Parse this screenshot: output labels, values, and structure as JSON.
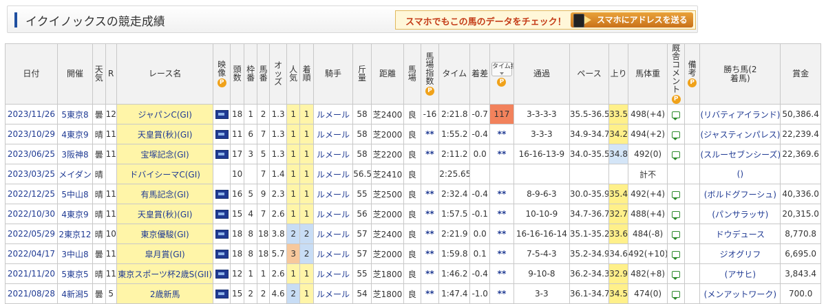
{
  "header": {
    "title": "イクイノックスの競走成績",
    "promo_text": "スマホでもこの馬のデータをチェック！",
    "promo_button": "スマホにアドレスを送る"
  },
  "columns": {
    "date": "日付",
    "venue": "開催",
    "weather": "天気",
    "r": "R",
    "race": "レース名",
    "video": "映像",
    "heads": "頭数",
    "frame": "枠番",
    "horse_no": "馬番",
    "odds": "オッズ",
    "pop": "人気",
    "rank": "着順",
    "jockey": "騎手",
    "weight": "斤量",
    "dist": "距離",
    "track": "馬場",
    "track_idx": "馬場指数",
    "time": "タイム",
    "margin": "着差",
    "time_idx": "タイム指数",
    "pass": "通過",
    "pace": "ペース",
    "last": "上り",
    "body": "馬体重",
    "stable": "厩舎コメント",
    "note": "備考",
    "winner": "勝ち馬(2着馬)",
    "prize": "賞金",
    "p": "P"
  },
  "rows": [
    {
      "date": "2023/11/26",
      "venue": "5東京8",
      "weather": "曇",
      "r": "12",
      "race": "ジャパンC(GI)",
      "video": true,
      "heads": "18",
      "frame": "1",
      "horse_no": "2",
      "odds": "1.3",
      "pop": "1",
      "rank": "1",
      "jockey": "ルメール",
      "weight": "58",
      "dist": "芝2400",
      "track": "良",
      "track_idx": "-16",
      "time": "2:21.8",
      "margin": "-0.7",
      "time_idx": "117",
      "pass": "3-3-3-3",
      "pace": "35.5-36.5",
      "last": "33.5",
      "body": "498(+4)",
      "comment": true,
      "winner": "(リバティアイランド)",
      "prize": "50,386.4"
    },
    {
      "date": "2023/10/29",
      "venue": "4東京9",
      "weather": "晴",
      "r": "11",
      "race": "天皇賞(秋)(GI)",
      "video": true,
      "heads": "11",
      "frame": "6",
      "horse_no": "7",
      "odds": "1.3",
      "pop": "1",
      "rank": "1",
      "jockey": "ルメール",
      "weight": "58",
      "dist": "芝2000",
      "track": "良",
      "track_idx": "**",
      "time": "1:55.2",
      "margin": "-0.4",
      "time_idx": "**",
      "pass": "3-3-3",
      "pace": "34.9-34.7",
      "last": "34.2",
      "body": "494(+2)",
      "comment": true,
      "winner": "(ジャスティンパレス)",
      "prize": "22,239.4"
    },
    {
      "date": "2023/06/25",
      "venue": "3阪神8",
      "weather": "曇",
      "r": "11",
      "race": "宝塚記念(GI)",
      "video": true,
      "heads": "17",
      "frame": "3",
      "horse_no": "5",
      "odds": "1.3",
      "pop": "1",
      "rank": "1",
      "jockey": "ルメール",
      "weight": "58",
      "dist": "芝2200",
      "track": "良",
      "track_idx": "**",
      "time": "2:11.2",
      "margin": "0.0",
      "time_idx": "**",
      "pass": "16-16-13-9",
      "pace": "34.0-35.5",
      "last": "34.8",
      "body": "492(0)",
      "comment": true,
      "winner": "(スルーセブンシーズ)",
      "prize": "22,369.6"
    },
    {
      "date": "2023/03/25",
      "venue": "メイダン",
      "weather": "晴",
      "r": "",
      "race": "ドバイシーマC(GI)",
      "video": false,
      "heads": "10",
      "frame": "",
      "horse_no": "7",
      "odds": "1.4",
      "pop": "1",
      "rank": "1",
      "jockey": "ルメール",
      "weight": "56.5",
      "dist": "芝2410",
      "track": "良",
      "track_idx": "",
      "time": "2:25.65",
      "margin": "",
      "time_idx": "",
      "pass": "",
      "pace": "",
      "last": "",
      "body": "計不",
      "comment": false,
      "winner": "()",
      "prize": ""
    },
    {
      "date": "2022/12/25",
      "venue": "5中山8",
      "weather": "晴",
      "r": "11",
      "race": "有馬記念(GI)",
      "video": true,
      "heads": "16",
      "frame": "5",
      "horse_no": "9",
      "odds": "2.3",
      "pop": "1",
      "rank": "1",
      "jockey": "ルメール",
      "weight": "55",
      "dist": "芝2500",
      "track": "良",
      "track_idx": "**",
      "time": "2:32.4",
      "margin": "-0.4",
      "time_idx": "**",
      "pass": "8-9-6-3",
      "pace": "30.0-35.9",
      "last": "35.4",
      "body": "492(+4)",
      "comment": true,
      "winner": "(ボルドグフーシュ)",
      "prize": "40,336.0"
    },
    {
      "date": "2022/10/30",
      "venue": "4東京9",
      "weather": "晴",
      "r": "11",
      "race": "天皇賞(秋)(GI)",
      "video": true,
      "heads": "15",
      "frame": "4",
      "horse_no": "7",
      "odds": "2.6",
      "pop": "1",
      "rank": "1",
      "jockey": "ルメール",
      "weight": "56",
      "dist": "芝2000",
      "track": "良",
      "track_idx": "**",
      "time": "1:57.5",
      "margin": "-0.1",
      "time_idx": "**",
      "pass": "10-10-9",
      "pace": "34.7-36.7",
      "last": "32.7",
      "body": "488(+4)",
      "comment": true,
      "winner": "(パンサラッサ)",
      "prize": "20,315.0"
    },
    {
      "date": "2022/05/29",
      "venue": "2東京12",
      "weather": "晴",
      "r": "10",
      "race": "東京優駿(GI)",
      "video": true,
      "heads": "18",
      "frame": "8",
      "horse_no": "18",
      "odds": "3.8",
      "pop": "2",
      "rank": "2",
      "jockey": "ルメール",
      "weight": "57",
      "dist": "芝2400",
      "track": "良",
      "track_idx": "**",
      "time": "2:21.9",
      "margin": "0.0",
      "time_idx": "**",
      "pass": "16-16-16-14",
      "pace": "35.1-35.2",
      "last": "33.6",
      "body": "484(-8)",
      "comment": true,
      "winner": "ドウデュース",
      "prize": "8,770.8"
    },
    {
      "date": "2022/04/17",
      "venue": "3中山8",
      "weather": "曇",
      "r": "11",
      "race": "皐月賞(GI)",
      "video": true,
      "heads": "18",
      "frame": "8",
      "horse_no": "18",
      "odds": "5.7",
      "pop": "3",
      "rank": "2",
      "jockey": "ルメール",
      "weight": "57",
      "dist": "芝2000",
      "track": "良",
      "track_idx": "**",
      "time": "1:59.8",
      "margin": "0.1",
      "time_idx": "**",
      "pass": "7-5-4-3",
      "pace": "35.2-34.9",
      "last": "34.6",
      "body": "492(+10)",
      "comment": true,
      "winner": "ジオグリフ",
      "prize": "6,695.0"
    },
    {
      "date": "2021/11/20",
      "venue": "5東京5",
      "weather": "晴",
      "r": "11",
      "race": "東京スポーツ杯2歳S(GII)",
      "video": true,
      "heads": "12",
      "frame": "1",
      "horse_no": "1",
      "odds": "2.6",
      "pop": "1",
      "rank": "1",
      "jockey": "ルメール",
      "weight": "55",
      "dist": "芝1800",
      "track": "良",
      "track_idx": "**",
      "time": "1:46.2",
      "margin": "-0.4",
      "time_idx": "**",
      "pass": "9-10-8",
      "pace": "36.2-34.3",
      "last": "32.9",
      "body": "482(+8)",
      "comment": true,
      "winner": "(アサヒ)",
      "prize": "3,843.4"
    },
    {
      "date": "2021/08/28",
      "venue": "4新潟5",
      "weather": "曇",
      "r": "5",
      "race": "2歳新馬",
      "video": true,
      "heads": "15",
      "frame": "2",
      "horse_no": "2",
      "odds": "4.6",
      "pop": "2",
      "rank": "1",
      "jockey": "ルメール",
      "weight": "54",
      "dist": "芝1800",
      "track": "良",
      "track_idx": "**",
      "time": "1:47.4",
      "margin": "-1.0",
      "time_idx": "**",
      "pass": "3-3",
      "pace": "36.1-34.7",
      "last": "34.5",
      "body": "474(0)",
      "comment": true,
      "winner": "(メンアットワーク)",
      "prize": "700.0"
    }
  ],
  "colors": {
    "highlight": "#fff5a8",
    "pop2": "#c8ddf5",
    "pop3": "#f7c89c",
    "up_yellow": "#fff08a",
    "up_blue": "#d4e5f7",
    "time_index_top": "#f2825c",
    "link": "#1f3a93"
  }
}
